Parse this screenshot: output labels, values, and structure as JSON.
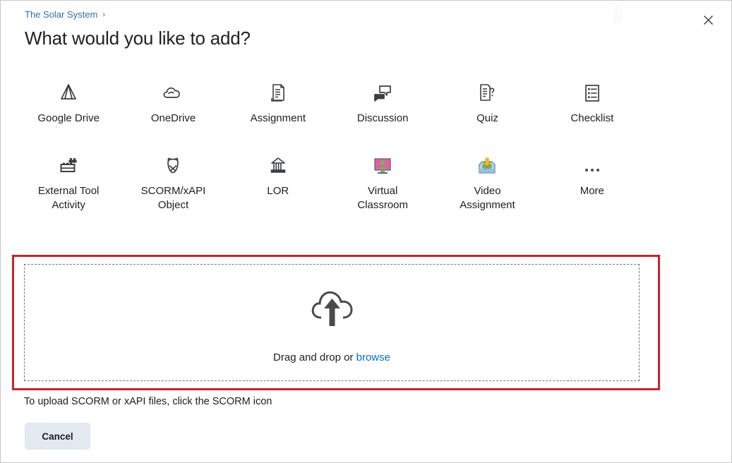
{
  "window": {
    "breadcrumb": "The Solar System",
    "breadcrumb_separator": "›",
    "title": "What would you like to add?",
    "close_label": "✕"
  },
  "tiles": [
    {
      "label": "Google Drive",
      "icon": "google-drive-icon"
    },
    {
      "label": "OneDrive",
      "icon": "onedrive-cloud-icon"
    },
    {
      "label": "Assignment",
      "icon": "assignment-document-icon"
    },
    {
      "label": "Discussion",
      "icon": "discussion-bubbles-icon"
    },
    {
      "label": "Quiz",
      "icon": "quiz-question-document-icon"
    },
    {
      "label": "Checklist",
      "icon": "checklist-list-icon"
    },
    {
      "label": "External Tool Activity",
      "icon": "external-tool-blocks-icon"
    },
    {
      "label": "SCORM/xAPI Object",
      "icon": "scorm-xapi-icon"
    },
    {
      "label": "LOR",
      "icon": "lor-building-icon"
    },
    {
      "label": "Virtual Classroom",
      "icon": "virtual-classroom-monitor-icon"
    },
    {
      "label": "Video Assignment",
      "icon": "video-assignment-inbox-icon"
    },
    {
      "label": "More",
      "icon": "more-ellipsis-icon"
    }
  ],
  "dropzone": {
    "icon": "upload-cloud-icon",
    "prompt": "Drag and drop or",
    "browse_label": "browse"
  },
  "footer": {
    "hint": "To upload SCORM or xAPI files, click the SCORM icon",
    "cancel_label": "Cancel"
  },
  "colors": {
    "link": "#006fbf",
    "highlight_border": "#c1272d",
    "icon_dark": "#3b3f42",
    "virtual_classroom_pink": "#e0609f",
    "virtual_classroom_green": "#6aba53",
    "video_blue": "#93b9e0",
    "video_yellow": "#f2c310"
  }
}
